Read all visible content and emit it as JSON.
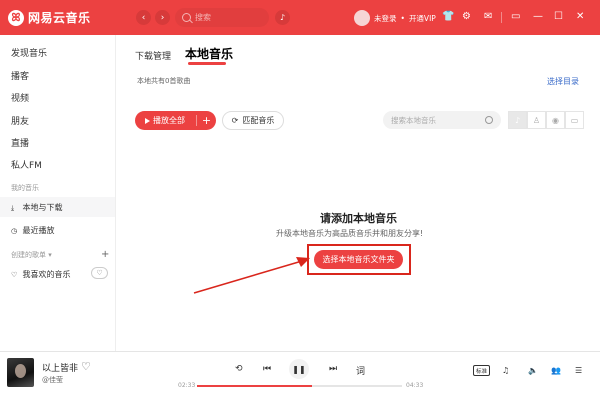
{
  "app": {
    "name": "网易云音乐"
  },
  "search": {
    "placeholder": "搜索"
  },
  "user": {
    "login": "未登录",
    "vip": "开通VIP"
  },
  "sidebar": {
    "items": [
      "发现音乐",
      "播客",
      "视频",
      "朋友",
      "直播",
      "私人FM"
    ],
    "my_music_title": "我的音乐",
    "my_music": [
      "本地与下载",
      "最近播放"
    ],
    "created_title": "创建的歌单",
    "created": [
      "我喜欢的音乐"
    ]
  },
  "tabs": {
    "download": "下载管理",
    "local": "本地音乐"
  },
  "local": {
    "count_text": "本地共有0首歌曲",
    "select_dir": "选择目录",
    "play_all": "播放全部",
    "match": "匹配音乐",
    "search_placeholder": "搜索本地音乐",
    "empty_title": "请添加本地音乐",
    "empty_sub": "升级本地音乐为高品质音乐并和朋友分享!",
    "choose_folder": "选择本地音乐文件夹"
  },
  "player": {
    "title": "以上皆非",
    "artist": "@佳莹",
    "current_time": "02:33",
    "total_time": "04:33",
    "progress": 0.56,
    "lyric": "词",
    "quality": "标准"
  },
  "colors": {
    "accent": "#ec4141",
    "link": "#3a6bc9",
    "annotation": "#d9261c"
  }
}
